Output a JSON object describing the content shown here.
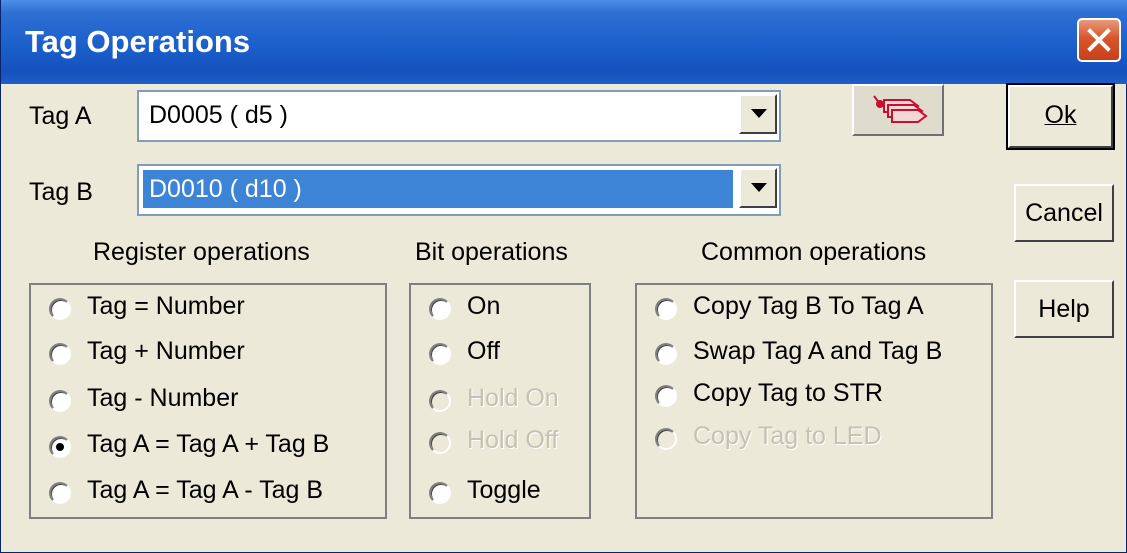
{
  "window": {
    "title": "Tag Operations"
  },
  "tag_a": {
    "label": "Tag A",
    "value": "D0005 ( d5 )"
  },
  "tag_b": {
    "label": "Tag B",
    "value": "D0010 ( d10 )"
  },
  "buttons": {
    "ok": "Ok",
    "cancel": "Cancel",
    "help": "Help"
  },
  "register_ops": {
    "title": "Register operations",
    "options": [
      "Tag  =  Number",
      "Tag  +  Number",
      "Tag  -  Number",
      "Tag A = Tag A + Tag B",
      "Tag A = Tag A - Tag B"
    ],
    "selected": "Tag A = Tag A + Tag B"
  },
  "bit_ops": {
    "title": "Bit operations",
    "options": [
      "On",
      "Off",
      "Hold On",
      "Hold Off",
      "Toggle"
    ],
    "disabled": [
      "Hold On",
      "Hold Off"
    ]
  },
  "common_ops": {
    "title": "Common operations",
    "options": [
      "Copy Tag B To Tag A",
      "Swap Tag A and Tag B",
      "Copy Tag to STR",
      "Copy Tag to LED"
    ],
    "disabled": [
      "Copy Tag to LED"
    ]
  },
  "icons": {
    "close": "close-icon",
    "tag_browse": "tags-icon",
    "dropdown": "chevron-down-icon"
  },
  "colors": {
    "title_bar": "#1b5fcb",
    "selection": "#3d84d6",
    "dialog_bg": "#ece9d8"
  }
}
